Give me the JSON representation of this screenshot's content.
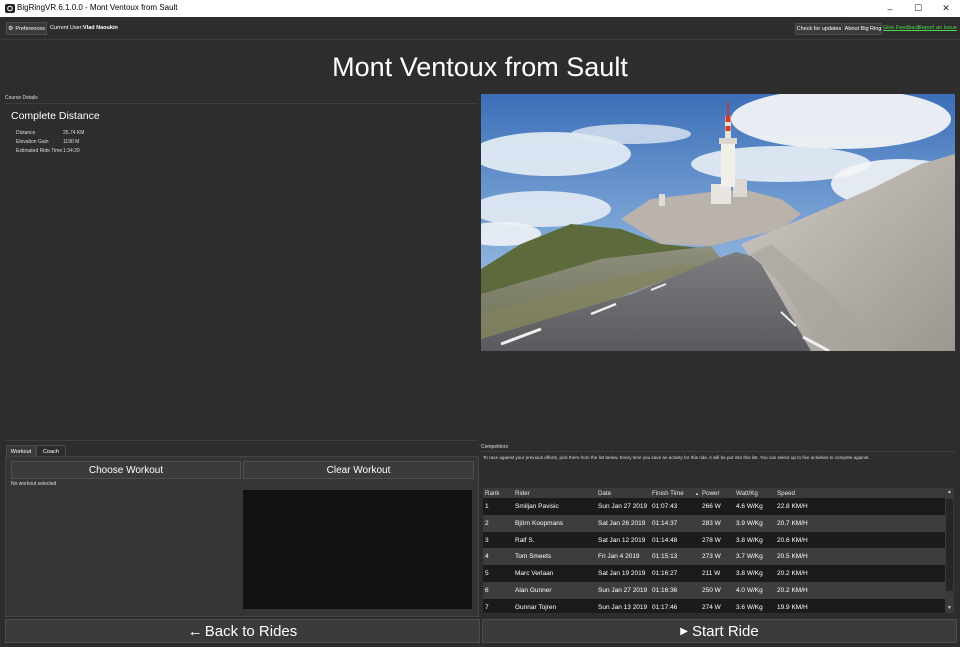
{
  "window": {
    "title": "BigRingVR 6.1.0.0 - Mont Ventoux from Sault",
    "min_glyph": "–",
    "max_glyph": "☐",
    "close_glyph": "✕"
  },
  "menubar": {
    "preferences_label": "Preferences",
    "current_user_label": "Current User:",
    "current_user_name": "Vlad Naoukin",
    "check_updates_label": "Check for updates",
    "about_label": "About Big Ring",
    "feedback_label": "Give Feedback",
    "report_issue_label": "Report an Issue"
  },
  "page": {
    "title": "Mont Ventoux from Sault"
  },
  "course": {
    "section_label": "Course Details",
    "title": "Complete Distance",
    "details": [
      {
        "key": "Distance",
        "value": "25.74 KM"
      },
      {
        "key": "Elevation Gain",
        "value": "1190 M"
      },
      {
        "key": "Estimated Ride Time",
        "value": "1:34:20"
      }
    ]
  },
  "workout": {
    "tabs": [
      "Workout",
      "Coach"
    ],
    "choose_label": "Choose Workout",
    "clear_label": "Clear Workout",
    "status": "No workout selected"
  },
  "competitors": {
    "section_label": "Competitors",
    "hint": "To race against your previous efforts, pick them from the list below. Every time you save an activity for this ride, it will be put into this list. You can select up to five activities to compete against.",
    "columns": [
      "Rank",
      "Rider",
      "Date",
      "Finish Time",
      "Power",
      "Watt/Kg",
      "Speed"
    ],
    "sort_glyph": "▲",
    "rows": [
      [
        "1",
        "Smiljan Pavisic",
        "Sun Jan 27 2019",
        "01:07:43",
        "266 W",
        "4.6 W/Kg",
        "22.8 KM/H"
      ],
      [
        "2",
        "Björn Koopmans",
        "Sat Jan 26 2019",
        "01:14:37",
        "283 W",
        "3.9 W/Kg",
        "20.7 KM/H"
      ],
      [
        "3",
        "Ralf S.",
        "Sat Jan 12 2019",
        "01:14:48",
        "278 W",
        "3.8 W/Kg",
        "20.6 KM/H"
      ],
      [
        "4",
        "Tom Smeets",
        "Fri Jan 4 2019",
        "01:15:13",
        "273 W",
        "3.7 W/Kg",
        "20.5 KM/H"
      ],
      [
        "5",
        "Marc Verlaan",
        "Sat Jan 19 2019",
        "01:16:27",
        "211 W",
        "3.8 W/Kg",
        "20.2 KM/H"
      ],
      [
        "6",
        "Alan Gunner",
        "Sun Jan 27 2019",
        "01:16:36",
        "250 W",
        "4.0 W/Kg",
        "20.2 KM/H"
      ],
      [
        "7",
        "Gunnar Tojren",
        "Sun Jan 13 2019",
        "01:17:46",
        "274 W",
        "3.6 W/Kg",
        "19.9 KM/H"
      ]
    ]
  },
  "footer": {
    "back_label": "Back to Rides",
    "back_icon": "←",
    "start_label": "Start Ride",
    "start_icon": "▶"
  },
  "colors": {
    "background": "#2d2d2d",
    "row_dark": "#1b1b1b",
    "row_light": "#3d3d3d",
    "link_green": "#4cd64c"
  }
}
